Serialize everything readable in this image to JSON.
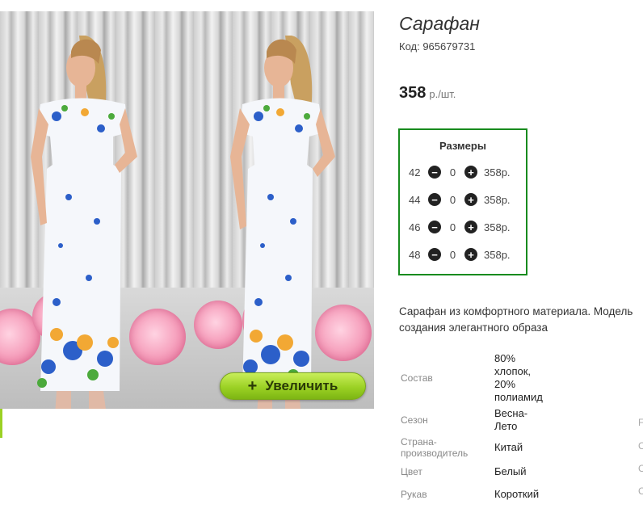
{
  "product": {
    "title": "Сарафан",
    "code_label": "Код: 965679731",
    "price_value": "358",
    "price_unit": "р./шт."
  },
  "photo": {
    "zoom_label": "Увеличить",
    "zoom_icon": "plus-icon"
  },
  "sizes": {
    "title": "Размеры",
    "rows": [
      {
        "size": "42",
        "qty": "0",
        "price": "358р."
      },
      {
        "size": "44",
        "qty": "0",
        "price": "358р."
      },
      {
        "size": "46",
        "qty": "0",
        "price": "358р."
      },
      {
        "size": "48",
        "qty": "0",
        "price": "358р."
      }
    ],
    "border_color": "#188b1e"
  },
  "description": {
    "line1": "Сарафан из комфортного материала. Модель",
    "line2": "создания элегантного образа"
  },
  "specs": [
    {
      "label": "Состав",
      "value_lines": [
        "80%",
        "хлопок,",
        "20%",
        "полиамид"
      ]
    },
    {
      "label": "Сезон",
      "value_lines": [
        "Весна-",
        "Лето"
      ]
    },
    {
      "label": "Страна-производитель",
      "label_lines": [
        "Страна-",
        "производитель"
      ],
      "value_lines": [
        "Китай"
      ]
    },
    {
      "label": "Цвет",
      "value_lines": [
        "Белый"
      ]
    },
    {
      "label": "Рукав",
      "value_lines": [
        "Короткий"
      ]
    }
  ],
  "edge_fragments": [
    "F",
    "С",
    "С",
    "С"
  ],
  "colors": {
    "accent_green": "#9bd124"
  }
}
